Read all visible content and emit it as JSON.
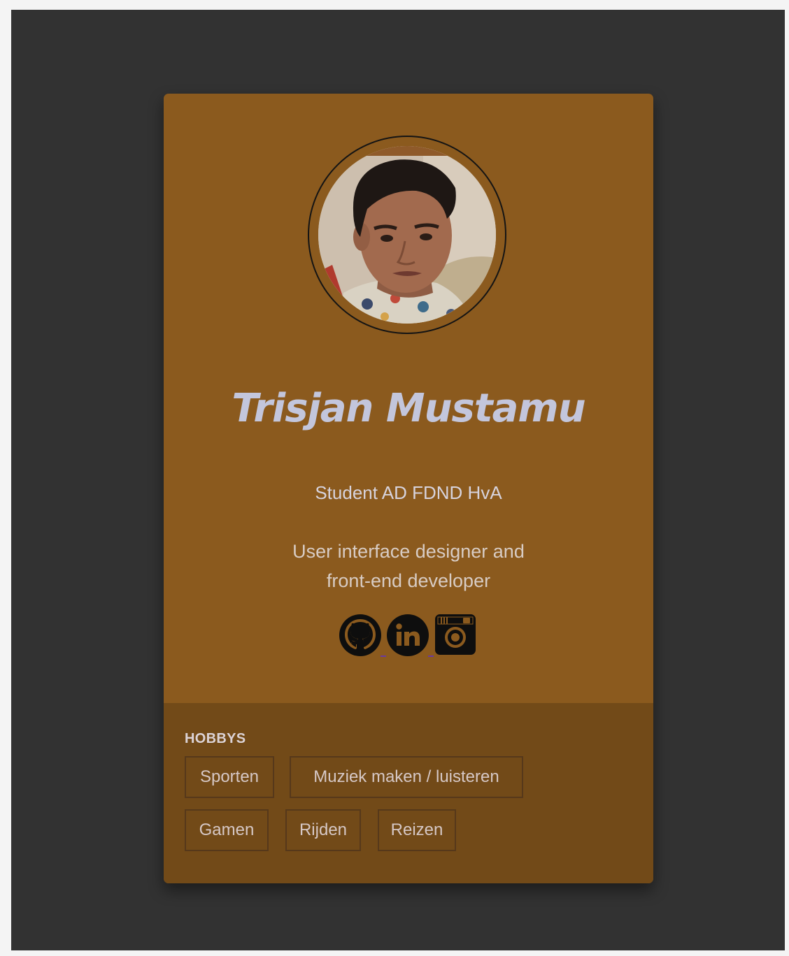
{
  "profile": {
    "name": "Trisjan Mustamu",
    "role": "Student AD FDND HvA",
    "description_line1": "User interface designer and",
    "description_line2": "front-end developer",
    "avatar_icon": "profile-photo"
  },
  "socials": [
    {
      "label": "GitHub",
      "icon": "github-icon"
    },
    {
      "label": "LinkedIn",
      "icon": "linkedin-icon"
    },
    {
      "label": "Instagram",
      "icon": "instagram-icon"
    }
  ],
  "hobbies": {
    "label": "HOBBYS",
    "items": [
      "Sporten",
      "Muziek maken / luisteren",
      "Gamen",
      "Rijden",
      "Reizen"
    ]
  },
  "colors": {
    "page_background": "#323232",
    "card_top": "#8b5a1e",
    "card_bottom": "#724a18",
    "name_text": "#c3c6dc",
    "icon": "#0e0e0e"
  }
}
